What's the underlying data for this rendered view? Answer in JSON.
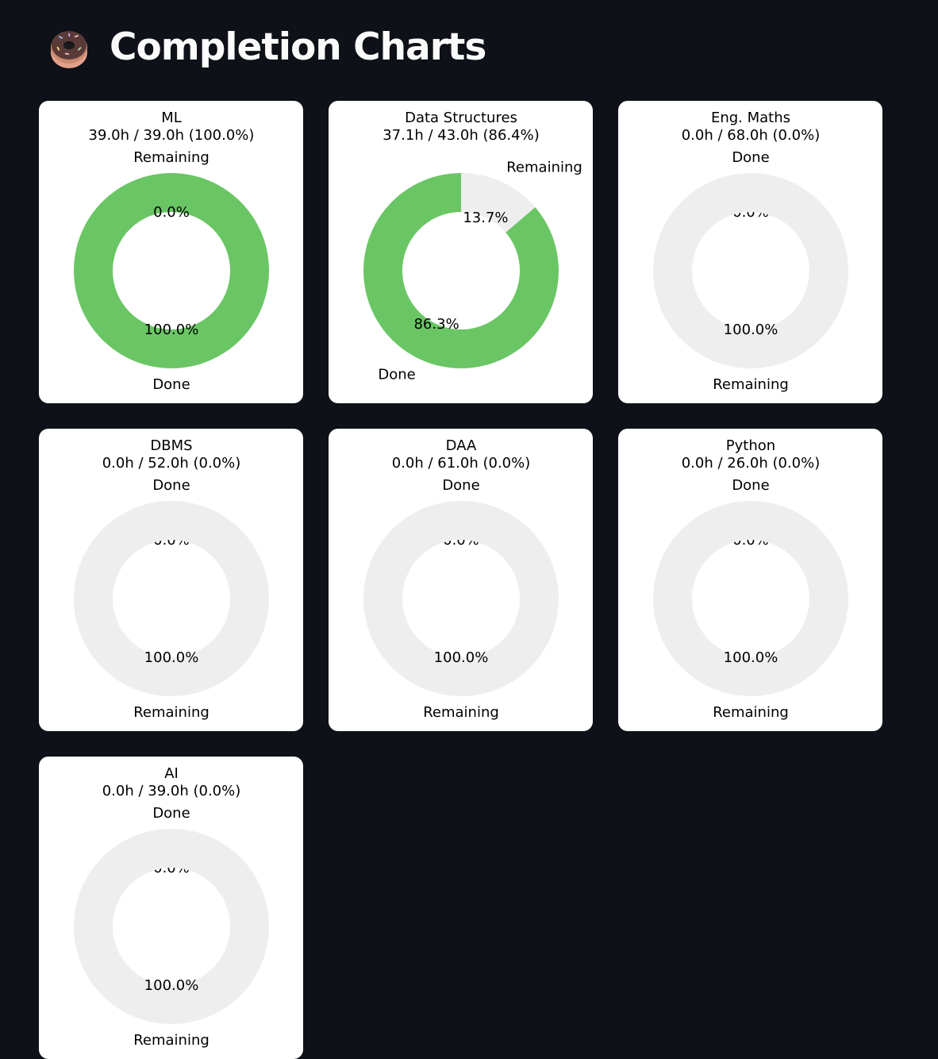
{
  "page": {
    "title": "Completion Charts",
    "icon": "donut-icon"
  },
  "colors": {
    "background": "#0e1117",
    "done": "#6ac664",
    "remaining": "#eeeeee",
    "card": "#ffffff",
    "text": "#000000"
  },
  "chart_data": [
    {
      "type": "pie",
      "variant": "donut",
      "title": "ML",
      "subtitle": "39.0h / 39.0h (100.0%)",
      "labels": [
        "Done",
        "Remaining"
      ],
      "values": [
        39.0,
        0.0
      ],
      "pct_labels": [
        "100.0%",
        "0.0%"
      ]
    },
    {
      "type": "pie",
      "variant": "donut",
      "title": "Data Structures",
      "subtitle": "37.1h / 43.0h (86.4%)",
      "labels": [
        "Done",
        "Remaining"
      ],
      "values": [
        37.1,
        5.9
      ],
      "pct_labels": [
        "86.3%",
        "13.7%"
      ]
    },
    {
      "type": "pie",
      "variant": "donut",
      "title": "Eng. Maths",
      "subtitle": "0.0h / 68.0h (0.0%)",
      "labels": [
        "Done",
        "Remaining"
      ],
      "values": [
        0.0,
        68.0
      ],
      "pct_labels": [
        "0.0%",
        "100.0%"
      ]
    },
    {
      "type": "pie",
      "variant": "donut",
      "title": "DBMS",
      "subtitle": "0.0h / 52.0h (0.0%)",
      "labels": [
        "Done",
        "Remaining"
      ],
      "values": [
        0.0,
        52.0
      ],
      "pct_labels": [
        "0.0%",
        "100.0%"
      ]
    },
    {
      "type": "pie",
      "variant": "donut",
      "title": "DAA",
      "subtitle": "0.0h / 61.0h (0.0%)",
      "labels": [
        "Done",
        "Remaining"
      ],
      "values": [
        0.0,
        61.0
      ],
      "pct_labels": [
        "0.0%",
        "100.0%"
      ]
    },
    {
      "type": "pie",
      "variant": "donut",
      "title": "Python",
      "subtitle": "0.0h / 26.0h (0.0%)",
      "labels": [
        "Done",
        "Remaining"
      ],
      "values": [
        0.0,
        26.0
      ],
      "pct_labels": [
        "0.0%",
        "100.0%"
      ]
    },
    {
      "type": "pie",
      "variant": "donut",
      "title": "AI",
      "subtitle": "0.0h / 39.0h (0.0%)",
      "labels": [
        "Done",
        "Remaining"
      ],
      "values": [
        0.0,
        39.0
      ],
      "pct_labels": [
        "0.0%",
        "100.0%"
      ]
    }
  ]
}
